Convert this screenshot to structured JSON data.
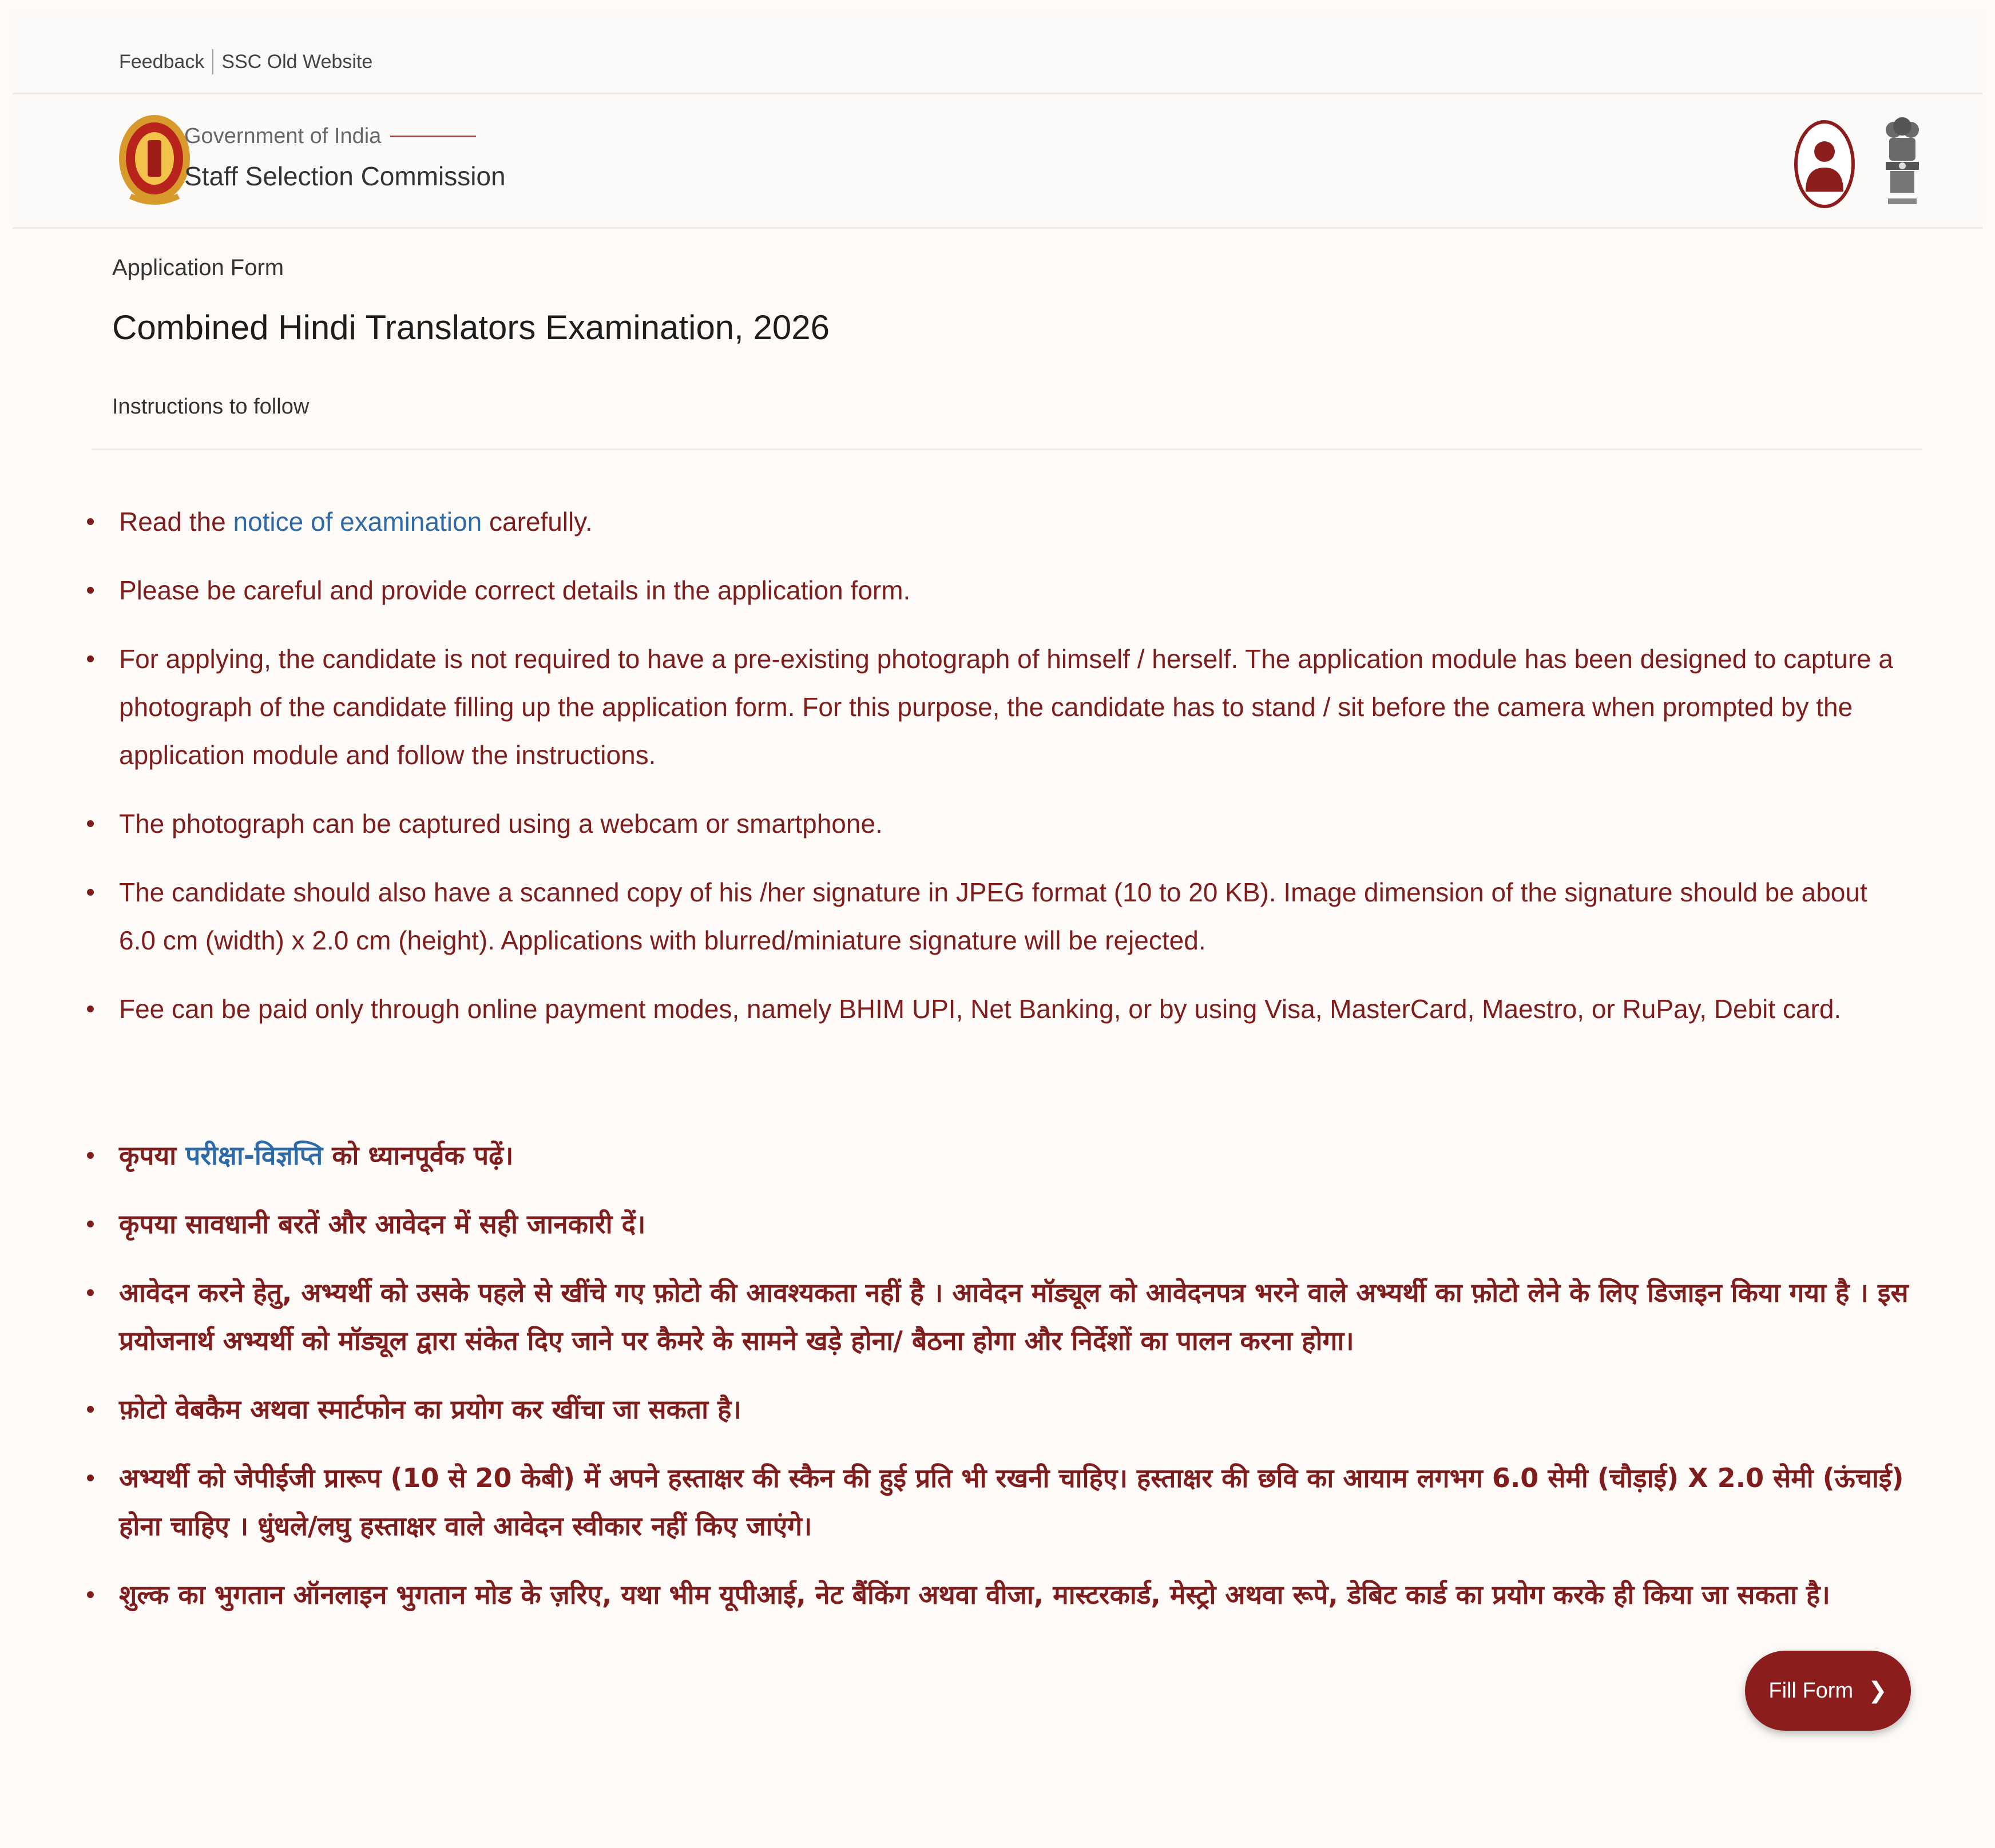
{
  "utility": {
    "feedback": "Feedback",
    "old_website": "SSC Old Website"
  },
  "header": {
    "gov_label": "Government of India",
    "org_name": "Staff Selection Commission"
  },
  "page": {
    "subtitle": "Application Form",
    "title": "Combined Hindi Translators Examination, 2026",
    "instructions_label": "Instructions to follow"
  },
  "english_items": [
    {
      "pre": "Read the ",
      "link": "notice of examination",
      "post": " carefully."
    },
    {
      "text": "Please be careful and provide correct details in the application form."
    },
    {
      "text": "For applying, the candidate is not required to have a pre-existing photograph of himself / herself. The application module has been designed to capture a photograph of the candidate filling up the application form. For this purpose, the candidate has to stand / sit before the camera when prompted by the application module and follow the instructions."
    },
    {
      "text": "The photograph can be captured using a webcam or smartphone."
    },
    {
      "text": "The candidate should also have a scanned copy of his /her signature in JPEG format (10 to 20 KB). Image dimension of the signature should be about 6.0 cm (width) x 2.0 cm (height). Applications with blurred/miniature signature will be rejected."
    },
    {
      "text": "Fee can be paid only through online payment modes, namely BHIM UPI, Net Banking, or by using Visa, MasterCard, Maestro, or RuPay, Debit card."
    }
  ],
  "hindi_items": [
    {
      "pre": "कृपया ",
      "link": "परीक्षा-विज्ञप्ति",
      "post": " को ध्यानपूर्वक पढ़ें।"
    },
    {
      "text": "कृपया सावधानी बरतें और आवेदन में सही जानकारी दें।"
    },
    {
      "text": "आवेदन करने हेतु, अभ्यर्थी को उसके पहले से खींचे गए फ़ोटो की आवश्यकता नहीं है । आवेदन मॉड्यूल को आवेदनपत्र भरने वाले अभ्यर्थी का फ़ोटो लेने के लिए डिजाइन किया गया है । इस प्रयोजनार्थ अभ्यर्थी को मॉड्यूल द्वारा संकेत दिए जाने पर कैमरे के सामने खड़े होना/ बैठना होगा और निर्देशों का पालन करना होगा।"
    },
    {
      "text": "फ़ोटो वेबकैम अथवा स्मार्टफोन का प्रयोग कर खींचा जा सकता है।"
    },
    {
      "text": "अभ्यर्थी को जेपीईजी प्रारूप (10 से 20 केबी) में अपने हस्ताक्षर की स्कैन की हुई प्रति भी रखनी चाहिए। हस्ताक्षर की छवि का आयाम लगभग 6.0 सेमी (चौड़ाई) X 2.0 सेमी (ऊंचाई) होना चाहिए । धुंधले/लघु हस्ताक्षर वाले आवेदन स्वीकार नहीं किए जाएंगे।"
    },
    {
      "text": "शुल्क का भुगतान ऑनलाइन भुगतान मोड के ज़रिए, यथा भीम यूपीआई, नेट बैंकिंग अथवा वीजा, मास्टरकार्ड, मेस्ट्रो अथवा रूपे, डेबिट कार्ड का प्रयोग करके ही किया जा सकता है।"
    }
  ],
  "actions": {
    "fill_form": "Fill Form"
  },
  "icons": {
    "logo": "ssc-logo-icon",
    "profile": "user-profile-icon",
    "emblem": "national-emblem-icon",
    "chevron": "chevron-right-icon"
  },
  "colors": {
    "accent": "#8b1d1d",
    "link": "#2d6aa8",
    "text": "#7f1d1d"
  }
}
